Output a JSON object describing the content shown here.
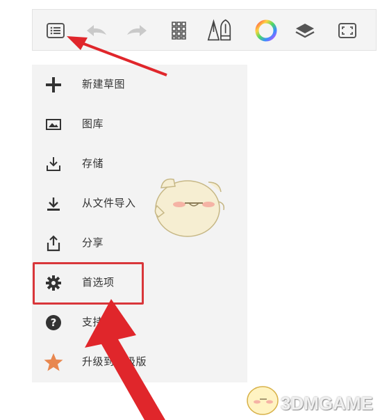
{
  "toolbar": {
    "icons": [
      {
        "name": "menu-list-icon"
      },
      {
        "name": "undo-icon"
      },
      {
        "name": "redo-icon"
      },
      {
        "name": "grid-icon"
      },
      {
        "name": "pen-tools-icon"
      },
      {
        "name": "color-wheel-icon"
      },
      {
        "name": "layers-icon"
      },
      {
        "name": "fullscreen-icon"
      }
    ]
  },
  "menu": {
    "items": [
      {
        "label": "新建草图",
        "icon": "plus-icon"
      },
      {
        "label": "图库",
        "icon": "gallery-icon"
      },
      {
        "label": "存储",
        "icon": "save-icon"
      },
      {
        "label": "从文件导入",
        "icon": "import-icon"
      },
      {
        "label": "分享",
        "icon": "share-icon"
      },
      {
        "label": "首选项",
        "icon": "gear-icon"
      },
      {
        "label": "支持",
        "icon": "help-icon"
      },
      {
        "label": "升级到高级版",
        "icon": "star-icon"
      }
    ]
  },
  "colors": {
    "highlight": "#d9363a",
    "arrow": "#e0262b",
    "star": "#e8874f"
  },
  "watermark": {
    "text": "3DMGAME"
  }
}
